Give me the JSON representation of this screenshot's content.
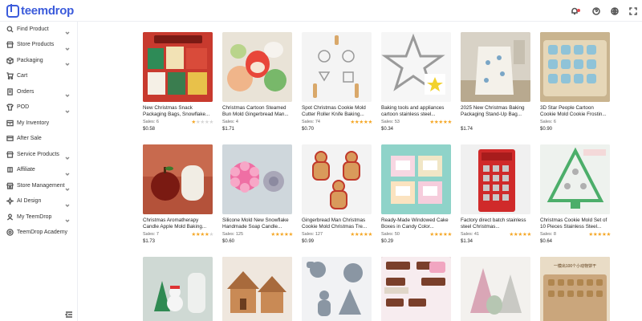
{
  "app": {
    "logo_text": "teemdrop"
  },
  "topbar": {
    "icons": [
      "bell-icon",
      "help-icon",
      "globe-icon",
      "fullscreen-icon"
    ]
  },
  "sidebar": {
    "items": [
      {
        "label": "Find Product",
        "icon": "search-icon",
        "has_chevron": true
      },
      {
        "label": "Store Products",
        "icon": "store-icon",
        "has_chevron": true
      },
      {
        "label": "Packaging",
        "icon": "box-icon",
        "has_chevron": true
      },
      {
        "label": "Cart",
        "icon": "cart-icon",
        "has_chevron": false
      },
      {
        "label": "Orders",
        "icon": "orders-icon",
        "has_chevron": true
      },
      {
        "label": "POD",
        "icon": "shirt-icon",
        "has_chevron": true
      },
      {
        "label": "My Inventory",
        "icon": "inventory-icon",
        "has_chevron": false
      },
      {
        "label": "After Sale",
        "icon": "after-sale-icon",
        "has_chevron": false
      },
      {
        "label": "Service Products",
        "icon": "service-icon",
        "has_chevron": true
      },
      {
        "label": "Affiliate",
        "icon": "affiliate-icon",
        "has_chevron": true
      },
      {
        "label": "Store Management",
        "icon": "management-icon",
        "has_chevron": true
      },
      {
        "label": "AI Design",
        "icon": "ai-icon",
        "has_chevron": true
      },
      {
        "label": "My TeemDrop",
        "icon": "user-icon",
        "has_chevron": true
      },
      {
        "label": "TeemDrop Academy",
        "icon": "academy-icon",
        "has_chevron": false
      }
    ]
  },
  "products": [
    {
      "title": "New Christmas Snack Packaging Bags, Snowflake...",
      "sales_label": "Sales:",
      "sales": "6",
      "rating": 1,
      "price": "$0.58",
      "thumb_color": "#c83a2e"
    },
    {
      "title": "Christmas Cartoon Steamed Bun Mold Gingerbread Man...",
      "sales_label": "Sales:",
      "sales": "4",
      "rating": 0,
      "price": "$1.71",
      "thumb_color": "#e9e3d7"
    },
    {
      "title": "Spot Christmas Cookie Mold Cutter Roller Knife Baking...",
      "sales_label": "Sales:",
      "sales": "74",
      "rating": 5,
      "price": "$0.70",
      "thumb_color": "#f4f4f4"
    },
    {
      "title": "Baking tools and appliances cartoon stainless steel...",
      "sales_label": "Sales:",
      "sales": "53",
      "rating": 5,
      "price": "$0.34",
      "thumb_color": "#f6f6f6"
    },
    {
      "title": "2025 New Christmas Baking Packaging Stand-Up Bag...",
      "sales_label": "",
      "sales": "",
      "rating": 0,
      "price": "$1.74",
      "thumb_color": "#d8d2c6"
    },
    {
      "title": "3D Star People Cartoon Cookie Mold Cookie Frostin...",
      "sales_label": "Sales:",
      "sales": "6",
      "rating": 0,
      "price": "$0.90",
      "thumb_color": "#c9b48f"
    },
    {
      "title": "Christmas Aromatherapy Candle Apple Mold Baking...",
      "sales_label": "Sales:",
      "sales": "7",
      "rating": 4,
      "price": "$1.73",
      "thumb_color": "#a43f2c"
    },
    {
      "title": "Silicone Mold New Snowflake Handmade Soap Candle...",
      "sales_label": "Sales:",
      "sales": "125",
      "rating": 5,
      "price": "$0.60",
      "thumb_color": "#cfd7dc"
    },
    {
      "title": "Gingerbread Man Christmas Cookie Mold Christmas Tre...",
      "sales_label": "Sales:",
      "sales": "127",
      "rating": 5,
      "price": "$0.99",
      "thumb_color": "#f3f3f3"
    },
    {
      "title": "Ready-Made Windowed Cake Boxes in Candy Color...",
      "sales_label": "Sales:",
      "sales": "50",
      "rating": 5,
      "price": "$0.29",
      "thumb_color": "#8fd3c9"
    },
    {
      "title": "Factory direct batch stainless steel Christmas...",
      "sales_label": "Sales:",
      "sales": "41",
      "rating": 5,
      "price": "$1.34",
      "thumb_color": "#e6e6e6"
    },
    {
      "title": "Christmas Cookie Mold Set of 10 Pieces Stainless Steel...",
      "sales_label": "Sales:",
      "sales": "8",
      "rating": 5,
      "price": "$0.64",
      "thumb_color": "#e3ebe4"
    },
    {
      "title": "",
      "sales_label": "",
      "sales": "",
      "rating": 0,
      "price": "",
      "thumb_color": "#cfd9d4"
    },
    {
      "title": "",
      "sales_label": "",
      "sales": "",
      "rating": 0,
      "price": "",
      "thumb_color": "#d7b79a"
    },
    {
      "title": "",
      "sales_label": "",
      "sales": "",
      "rating": 0,
      "price": "",
      "thumb_color": "#e5e7ea"
    },
    {
      "title": "",
      "sales_label": "",
      "sales": "",
      "rating": 0,
      "price": "",
      "thumb_color": "#7a4a37"
    },
    {
      "title": "",
      "sales_label": "",
      "sales": "",
      "rating": 0,
      "price": "",
      "thumb_color": "#ded9d2"
    },
    {
      "title": "",
      "sales_label": "",
      "sales": "",
      "rating": 0,
      "price": "",
      "thumb_color": "#caa67c"
    }
  ],
  "row3_thumb_texts": {
    "p17_banner": "一模出100个小动物饼干"
  }
}
